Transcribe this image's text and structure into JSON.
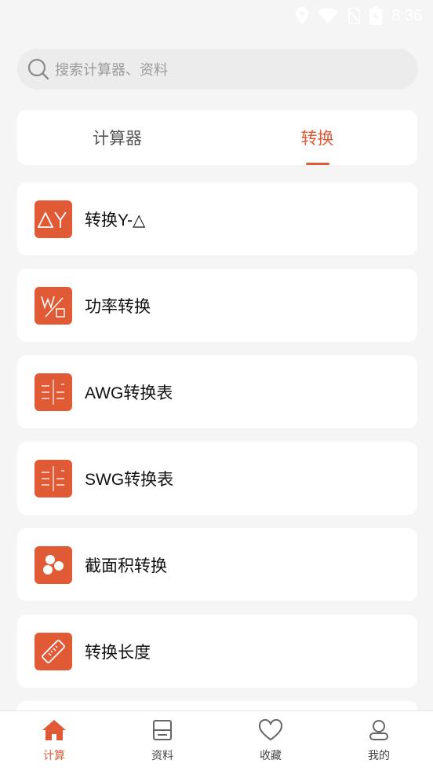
{
  "status": {
    "time": "8:36"
  },
  "search": {
    "placeholder": "搜索计算器、资料"
  },
  "tabs": [
    {
      "label": "计算器",
      "active": false
    },
    {
      "label": "转换",
      "active": true
    }
  ],
  "items": [
    {
      "label": "转换Y-△",
      "icon": "delta-y-icon"
    },
    {
      "label": "功率转换",
      "icon": "power-w-icon"
    },
    {
      "label": "AWG转换表",
      "icon": "awg-table-icon"
    },
    {
      "label": "SWG转换表",
      "icon": "swg-table-icon"
    },
    {
      "label": "截面积转换",
      "icon": "cross-section-icon"
    },
    {
      "label": "转换长度",
      "icon": "ruler-icon"
    }
  ],
  "nav": [
    {
      "label": "计算",
      "icon": "home-icon",
      "active": true
    },
    {
      "label": "资料",
      "icon": "document-icon",
      "active": false
    },
    {
      "label": "收藏",
      "icon": "heart-icon",
      "active": false
    },
    {
      "label": "我的",
      "icon": "profile-icon",
      "active": false
    }
  ],
  "colors": {
    "accent": "#e05a36",
    "background": "#f5f5f5"
  }
}
